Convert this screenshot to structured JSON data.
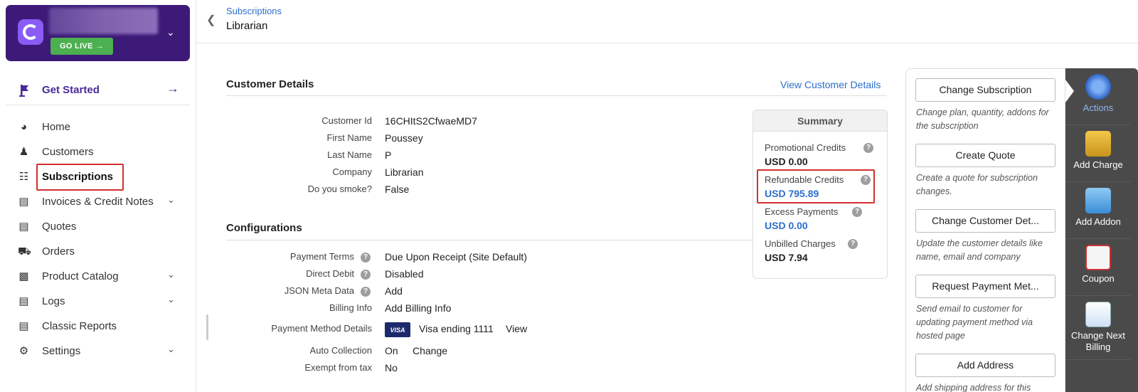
{
  "sidebar": {
    "go_live_label": "GO LIVE",
    "get_started_label": "Get Started",
    "items": [
      {
        "label": "Home"
      },
      {
        "label": "Customers"
      },
      {
        "label": "Subscriptions"
      },
      {
        "label": "Invoices & Credit Notes"
      },
      {
        "label": "Quotes"
      },
      {
        "label": "Orders"
      },
      {
        "label": "Product Catalog"
      },
      {
        "label": "Logs"
      },
      {
        "label": "Classic Reports"
      },
      {
        "label": "Settings"
      }
    ]
  },
  "header": {
    "breadcrumb": "Subscriptions",
    "title": "Librarian"
  },
  "customer_details": {
    "title": "Customer Details",
    "view_link": "View Customer Details",
    "fields": [
      {
        "label": "Customer Id",
        "value": "16CHItS2CfwaeMD7"
      },
      {
        "label": "First Name",
        "value": "Poussey"
      },
      {
        "label": "Last Name",
        "value": "P"
      },
      {
        "label": "Company",
        "value": "Librarian"
      },
      {
        "label": "Do you smoke?",
        "value": "False"
      }
    ]
  },
  "configurations": {
    "title": "Configurations",
    "payment_terms": {
      "label": "Payment Terms",
      "value": "Due Upon Receipt (Site Default)"
    },
    "direct_debit": {
      "label": "Direct Debit",
      "value": "Disabled"
    },
    "json_meta": {
      "label": "JSON Meta Data",
      "value": "Add"
    },
    "billing_info": {
      "label": "Billing Info",
      "value": "Add Billing Info"
    },
    "payment_method": {
      "label": "Payment Method Details",
      "card_brand": "VISA",
      "value": "Visa ending 1111",
      "view_link": "View"
    },
    "auto_collection": {
      "label": "Auto Collection",
      "value": "On",
      "change_link": "Change"
    },
    "exempt_tax": {
      "label": "Exempt from tax",
      "value": "No"
    }
  },
  "summary": {
    "title": "Summary",
    "items": [
      {
        "label": "Promotional Credits",
        "value": "USD 0.00"
      },
      {
        "label": "Refundable Credits",
        "value": "USD 795.89"
      },
      {
        "label": "Excess Payments",
        "value": "USD 0.00"
      },
      {
        "label": "Unbilled Charges",
        "value": "USD 7.94"
      }
    ]
  },
  "actions": {
    "buttons": [
      {
        "label": "Change Subscription",
        "desc": "Change plan, quantity, addons for the subscription"
      },
      {
        "label": "Create Quote",
        "desc": "Create a quote for subscription changes."
      },
      {
        "label": "Change Customer Det...",
        "desc": "Update the customer details like name, email and company"
      },
      {
        "label": "Request Payment Met...",
        "desc": "Send email to customer for updating payment method via hosted page"
      },
      {
        "label": "Add Address",
        "desc": "Add shipping address for this"
      }
    ],
    "strip": [
      {
        "label": "Actions",
        "icon": "gear-icon"
      },
      {
        "label": "Add Charge",
        "icon": "coins-icon"
      },
      {
        "label": "Add Addon",
        "icon": "cube-icon"
      },
      {
        "label": "Coupon",
        "icon": "coupon-icon"
      },
      {
        "label": "Change Next Billing",
        "icon": "calendar-icon"
      }
    ]
  },
  "colors": {
    "brand": "#3d1a78",
    "accent": "#2c6fcc",
    "go_live": "#4caf50",
    "highlight": "#d32f2f"
  }
}
